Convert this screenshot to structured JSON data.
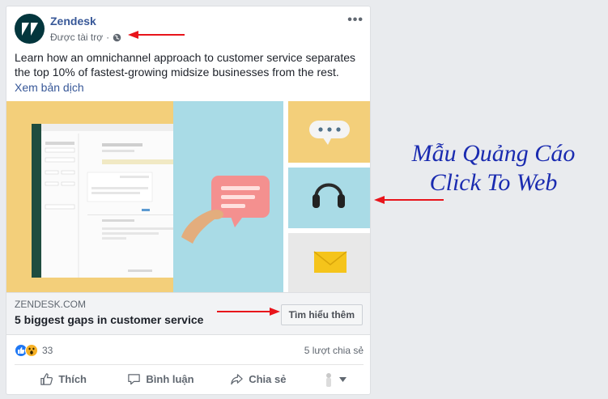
{
  "post": {
    "page_name": "Zendesk",
    "sponsored_label": "Được tài trợ",
    "separator": "·",
    "more_label": "•••",
    "body": "Learn how an omnichannel approach to customer service separates the top 10% of fastest-growing midsize businesses from the rest.",
    "see_translation": "Xem bản dịch",
    "link": {
      "domain": "ZENDESK.COM",
      "title": "5 biggest gaps in customer service",
      "cta": "Tìm hiểu thêm"
    },
    "stats": {
      "reaction_count": "33",
      "shares": "5 lượt chia sẻ"
    },
    "actions": {
      "like": "Thích",
      "comment": "Bình luận",
      "share": "Chia sẻ"
    }
  },
  "annotation": {
    "line1": "Mẫu Quảng Cáo",
    "line2": "Click To Web"
  },
  "colors": {
    "accent": "#385898",
    "annotation": "#1a2bb0",
    "arrow": "#e8141b",
    "brand": "#03363d"
  }
}
